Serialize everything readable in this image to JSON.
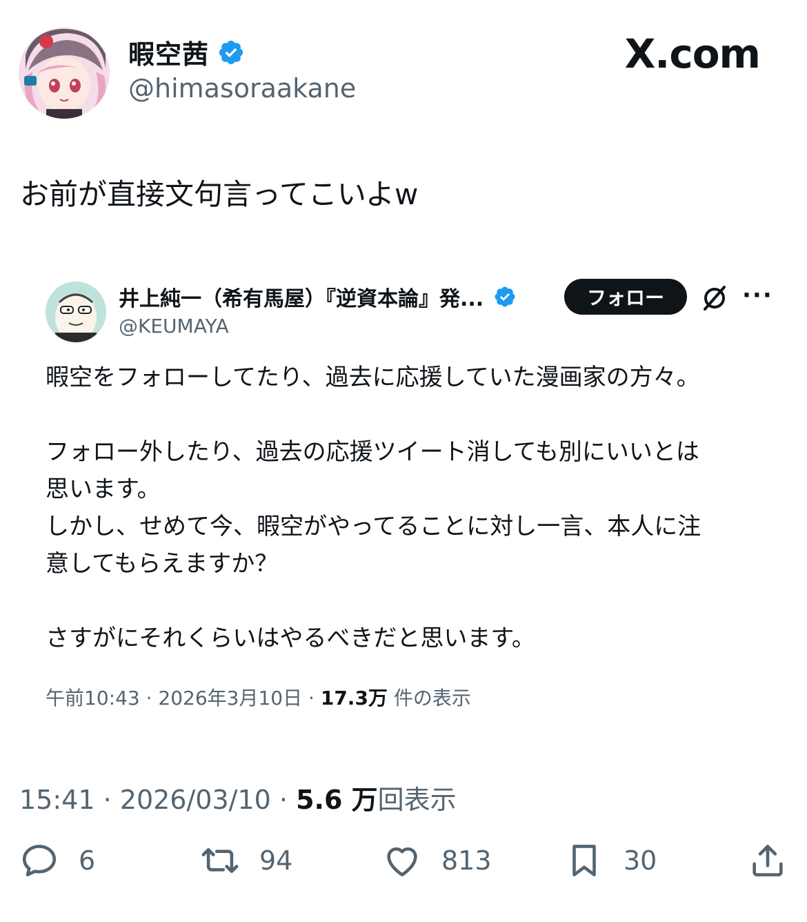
{
  "author": {
    "display_name": "暇空茜",
    "handle": "@himasoraakane",
    "verified": true
  },
  "brand": "X.com",
  "tweet_text": "お前が直接文句言ってこいよw",
  "quoted": {
    "display_name": "井上純一（希有馬屋）『逆資本論』発...",
    "handle": "@KEUMAYA",
    "follow_label": "フォロー",
    "body": [
      "暇空をフォローしてたり、過去に応援していた漫画家の方々。",
      "",
      "フォロー外したり、過去の応援ツイート消しても別にいいとは",
      "思います。",
      "しかし、せめて今、暇空がやってることに対し一言、本人に注",
      "意してもらえますか？",
      "",
      "さすがにそれくらいはやるべきだと思います。"
    ],
    "meta": {
      "time": "午前10:43",
      "date": "2026年3月10日",
      "views": "17.3万",
      "views_suffix": "件の表示"
    }
  },
  "meta": {
    "time": "15:41",
    "date": "2026/03/10",
    "views": "5.6 万",
    "views_suffix": "回表示"
  },
  "actions": {
    "replies": "6",
    "reposts": "94",
    "likes": "813",
    "bookmarks": "30"
  },
  "colors": {
    "verified": "#1d9bf0",
    "muted": "#536471",
    "text": "#0f1419"
  }
}
